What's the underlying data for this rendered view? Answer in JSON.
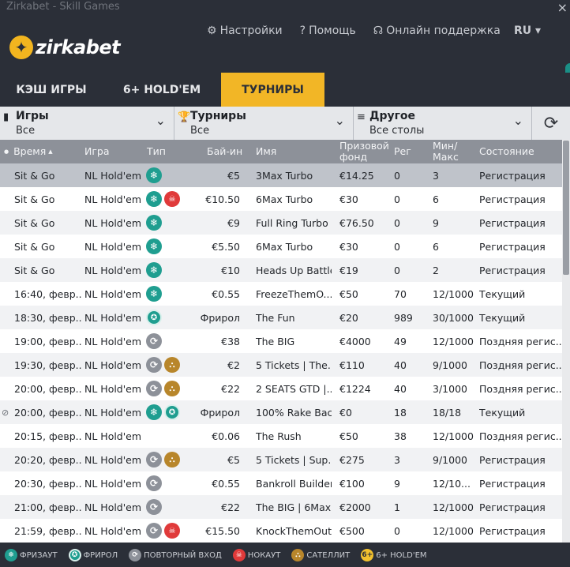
{
  "window": {
    "title": "Zirkabet - Skill Games",
    "close": "×"
  },
  "header": {
    "logo": "zirkabet",
    "nav": [
      {
        "icon": "gear-icon",
        "glyph": "⚙",
        "label": "Настройки"
      },
      {
        "icon": "help-icon",
        "glyph": "?",
        "label": "Помощь"
      },
      {
        "icon": "headset-icon",
        "glyph": "☊",
        "label": "Онлайн поддержка"
      }
    ],
    "lang": "RU ▾"
  },
  "tabs": [
    "КЭШ ИГРЫ",
    "6+ HOLD'EM",
    "ТУРНИРЫ"
  ],
  "filters": [
    {
      "icon": "cards-icon",
      "glyph": "▮",
      "label": "Игры",
      "value": "Все"
    },
    {
      "icon": "trophy-icon",
      "glyph": "🏆",
      "label": "Турниры",
      "value": "Все"
    },
    {
      "icon": "list-icon",
      "glyph": "≡",
      "label": "Другое",
      "value": "Все столы"
    }
  ],
  "refresh_glyph": "⟳",
  "columns": {
    "time": "Время",
    "game": "Игра",
    "type": "Тип",
    "buyin": "Бай-ин",
    "name": "Имя",
    "prize_line1": "Призовой",
    "prize_line2": "фонд",
    "reg": "Рег",
    "minmax_line1": "Мин/",
    "minmax_line2": "Макс",
    "state": "Состояние"
  },
  "rows": [
    {
      "time": "Sit & Go",
      "game": "NL Hold'em",
      "types": [
        "freeze"
      ],
      "buyin": "€5",
      "name": "3Max Turbo",
      "prize": "€14.25",
      "reg": "0",
      "minmax": "3",
      "state": "Регистрация",
      "selected": true
    },
    {
      "time": "Sit & Go",
      "game": "NL Hold'em",
      "types": [
        "freeze",
        "knockout"
      ],
      "buyin": "€10.50",
      "name": "6Max Turbo",
      "prize": "€30",
      "reg": "0",
      "minmax": "6",
      "state": "Регистрация"
    },
    {
      "time": "Sit & Go",
      "game": "NL Hold'em",
      "types": [
        "freeze"
      ],
      "buyin": "€9",
      "name": "Full Ring Turbo",
      "prize": "€76.50",
      "reg": "0",
      "minmax": "9",
      "state": "Регистрация"
    },
    {
      "time": "Sit & Go",
      "game": "NL Hold'em",
      "types": [
        "freeze"
      ],
      "buyin": "€5.50",
      "name": "6Max Turbo",
      "prize": "€30",
      "reg": "0",
      "minmax": "6",
      "state": "Регистрация"
    },
    {
      "time": "Sit & Go",
      "game": "NL Hold'em",
      "types": [
        "freeze"
      ],
      "buyin": "€10",
      "name": "Heads Up Battle",
      "prize": "€19",
      "reg": "0",
      "minmax": "2",
      "state": "Регистрация"
    },
    {
      "time": "16:40, февр...",
      "game": "NL Hold'em",
      "types": [
        "freeze"
      ],
      "buyin": "€0.55",
      "name": "FreezeThemO...",
      "prize": "€50",
      "reg": "70",
      "minmax": "12/1000",
      "state": "Текущий"
    },
    {
      "time": "18:30, февр...",
      "game": "NL Hold'em",
      "types": [
        "freeroll"
      ],
      "buyin": "Фрирол",
      "name": "The Fun",
      "prize": "€20",
      "reg": "989",
      "minmax": "30/1000",
      "state": "Текущий"
    },
    {
      "time": "19:00, февр...",
      "game": "NL Hold'em",
      "types": [
        "reentry"
      ],
      "buyin": "€38",
      "name": "The BIG",
      "prize": "€4000",
      "reg": "49",
      "minmax": "12/1000",
      "state": "Поздняя регис..."
    },
    {
      "time": "19:30, февр...",
      "game": "NL Hold'em",
      "types": [
        "reentry",
        "satellite"
      ],
      "buyin": "€2",
      "name": "5 Tickets | The...",
      "prize": "€110",
      "reg": "40",
      "minmax": "9/1000",
      "state": "Поздняя регис..."
    },
    {
      "time": "20:00, февр...",
      "game": "NL Hold'em",
      "types": [
        "reentry",
        "satellite"
      ],
      "buyin": "€22",
      "name": "2 SEATS GTD |...",
      "prize": "€1224",
      "reg": "40",
      "minmax": "3/1000",
      "state": "Поздняя регис..."
    },
    {
      "time": "20:00, февр...",
      "game": "NL Hold'em",
      "types": [
        "freeze",
        "freeroll"
      ],
      "buyin": "Фрирол",
      "name": "100% Rake Bac...",
      "prize": "€0",
      "reg": "18",
      "minmax": "18/18",
      "state": "Текущий",
      "locked": true
    },
    {
      "time": "20:15, февр...",
      "game": "NL Hold'em",
      "types": [],
      "buyin": "€0.06",
      "name": "The Rush",
      "prize": "€50",
      "reg": "38",
      "minmax": "12/1000",
      "state": "Поздняя регис..."
    },
    {
      "time": "20:20, февр...",
      "game": "NL Hold'em",
      "types": [
        "reentry",
        "satellite"
      ],
      "buyin": "€5",
      "name": "5 Tickets | Sup...",
      "prize": "€275",
      "reg": "3",
      "minmax": "9/1000",
      "state": "Регистрация"
    },
    {
      "time": "20:30, февр...",
      "game": "NL Hold'em",
      "types": [
        "reentry"
      ],
      "buyin": "€0.55",
      "name": "Bankroll Builder",
      "prize": "€100",
      "reg": "9",
      "minmax": "12/10...",
      "state": "Регистрация"
    },
    {
      "time": "21:00, февр...",
      "game": "NL Hold'em",
      "types": [
        "reentry"
      ],
      "buyin": "€22",
      "name": "The BIG | 6Max",
      "prize": "€2000",
      "reg": "1",
      "minmax": "12/1000",
      "state": "Регистрация"
    },
    {
      "time": "21:59, февр...",
      "game": "NL Hold'em",
      "types": [
        "reentry",
        "knockout"
      ],
      "buyin": "€15.50",
      "name": "KnockThemOut",
      "prize": "€500",
      "reg": "0",
      "minmax": "12/1000",
      "state": "Регистрация"
    }
  ],
  "badge_glyphs": {
    "freeze": "❄",
    "freeroll": "✪",
    "reentry": "⟳",
    "knockout": "☠",
    "satellite": "⛬",
    "six": "6+"
  },
  "legend": [
    {
      "type": "freeze",
      "label": "ФРИЗАУТ"
    },
    {
      "type": "freeroll",
      "label": "ФРИРОЛ"
    },
    {
      "type": "reentry",
      "label": "ПОВТОРНЫЙ ВХОД"
    },
    {
      "type": "knockout",
      "label": "НОКАУТ"
    },
    {
      "type": "satellite",
      "label": "САТЕЛЛИТ"
    },
    {
      "type": "six",
      "label": "6+ HOLD'EM"
    }
  ]
}
